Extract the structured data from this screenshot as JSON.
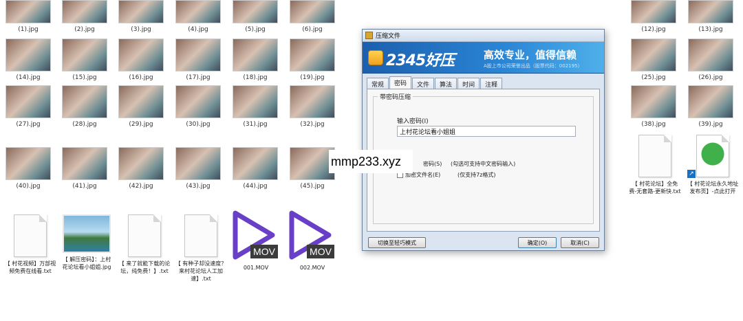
{
  "files": {
    "row_top": [
      "(1).jpg",
      "(2).jpg",
      "(3).jpg",
      "(4).jpg",
      "(5).jpg",
      "(6).jpg",
      "(12).jpg",
      "(13).jpg"
    ],
    "row_a": [
      "(14).jpg",
      "(15).jpg",
      "(16).jpg",
      "(17).jpg",
      "(18).jpg",
      "(19).jpg",
      "(25).jpg",
      "(26).jpg"
    ],
    "row_b": [
      "(27).jpg",
      "(28).jpg",
      "(29).jpg",
      "(30).jpg",
      "(31).jpg",
      "(32).jpg",
      "(38).jpg",
      "(39).jpg"
    ],
    "row_c": [
      "(40).jpg",
      "(41).jpg",
      "(42).jpg",
      "(43).jpg",
      "(44).jpg",
      "(45).jpg"
    ],
    "side_docs": [
      "【 村花论坛】全免费-无套路-更新快.txt",
      "【 村花论坛永久地址发布页】-点此打开"
    ],
    "bottom_docs": [
      "【 村花视频】万部视频免费在线看.txt",
      "【 解压密码】：上村花论坛看小姐姐.jpg",
      "【 来了就能下载的论坛，纯免费！】.txt",
      "【 有种子却没速度？来村花论坛人工加速】.txt"
    ],
    "movies": [
      "001.MOV",
      "002.MOV"
    ],
    "mov_badge": "MOV"
  },
  "dialog": {
    "title": "压缩文件",
    "brand": "2345好压",
    "slogan": "高效专业，值得信赖",
    "subline": "A股上市公司荣誉出品（股票代码：002195）",
    "tabs": [
      "常规",
      "密码",
      "文件",
      "算法",
      "时间",
      "注释"
    ],
    "active_tab": 1,
    "group_title": "带密码压缩",
    "password_label": "输入密码(I)",
    "password_value": "上村花论坛看小姐姐",
    "option_show": "密码(S)",
    "option_show_hint": "(勾选可支持中文密码输入)",
    "option_encrypt": "加密文件名(E)",
    "option_encrypt_hint": "(仅支持7z格式)",
    "button_mode": "切换至轻巧模式",
    "button_ok": "确定(O)",
    "button_cancel": "取消(C)"
  },
  "watermark": "mmp233.xyz",
  "colors": {
    "banner": "#2b86d6",
    "mov_purple": "#6a3fc8",
    "dialog_bg": "#dbe5f1"
  }
}
